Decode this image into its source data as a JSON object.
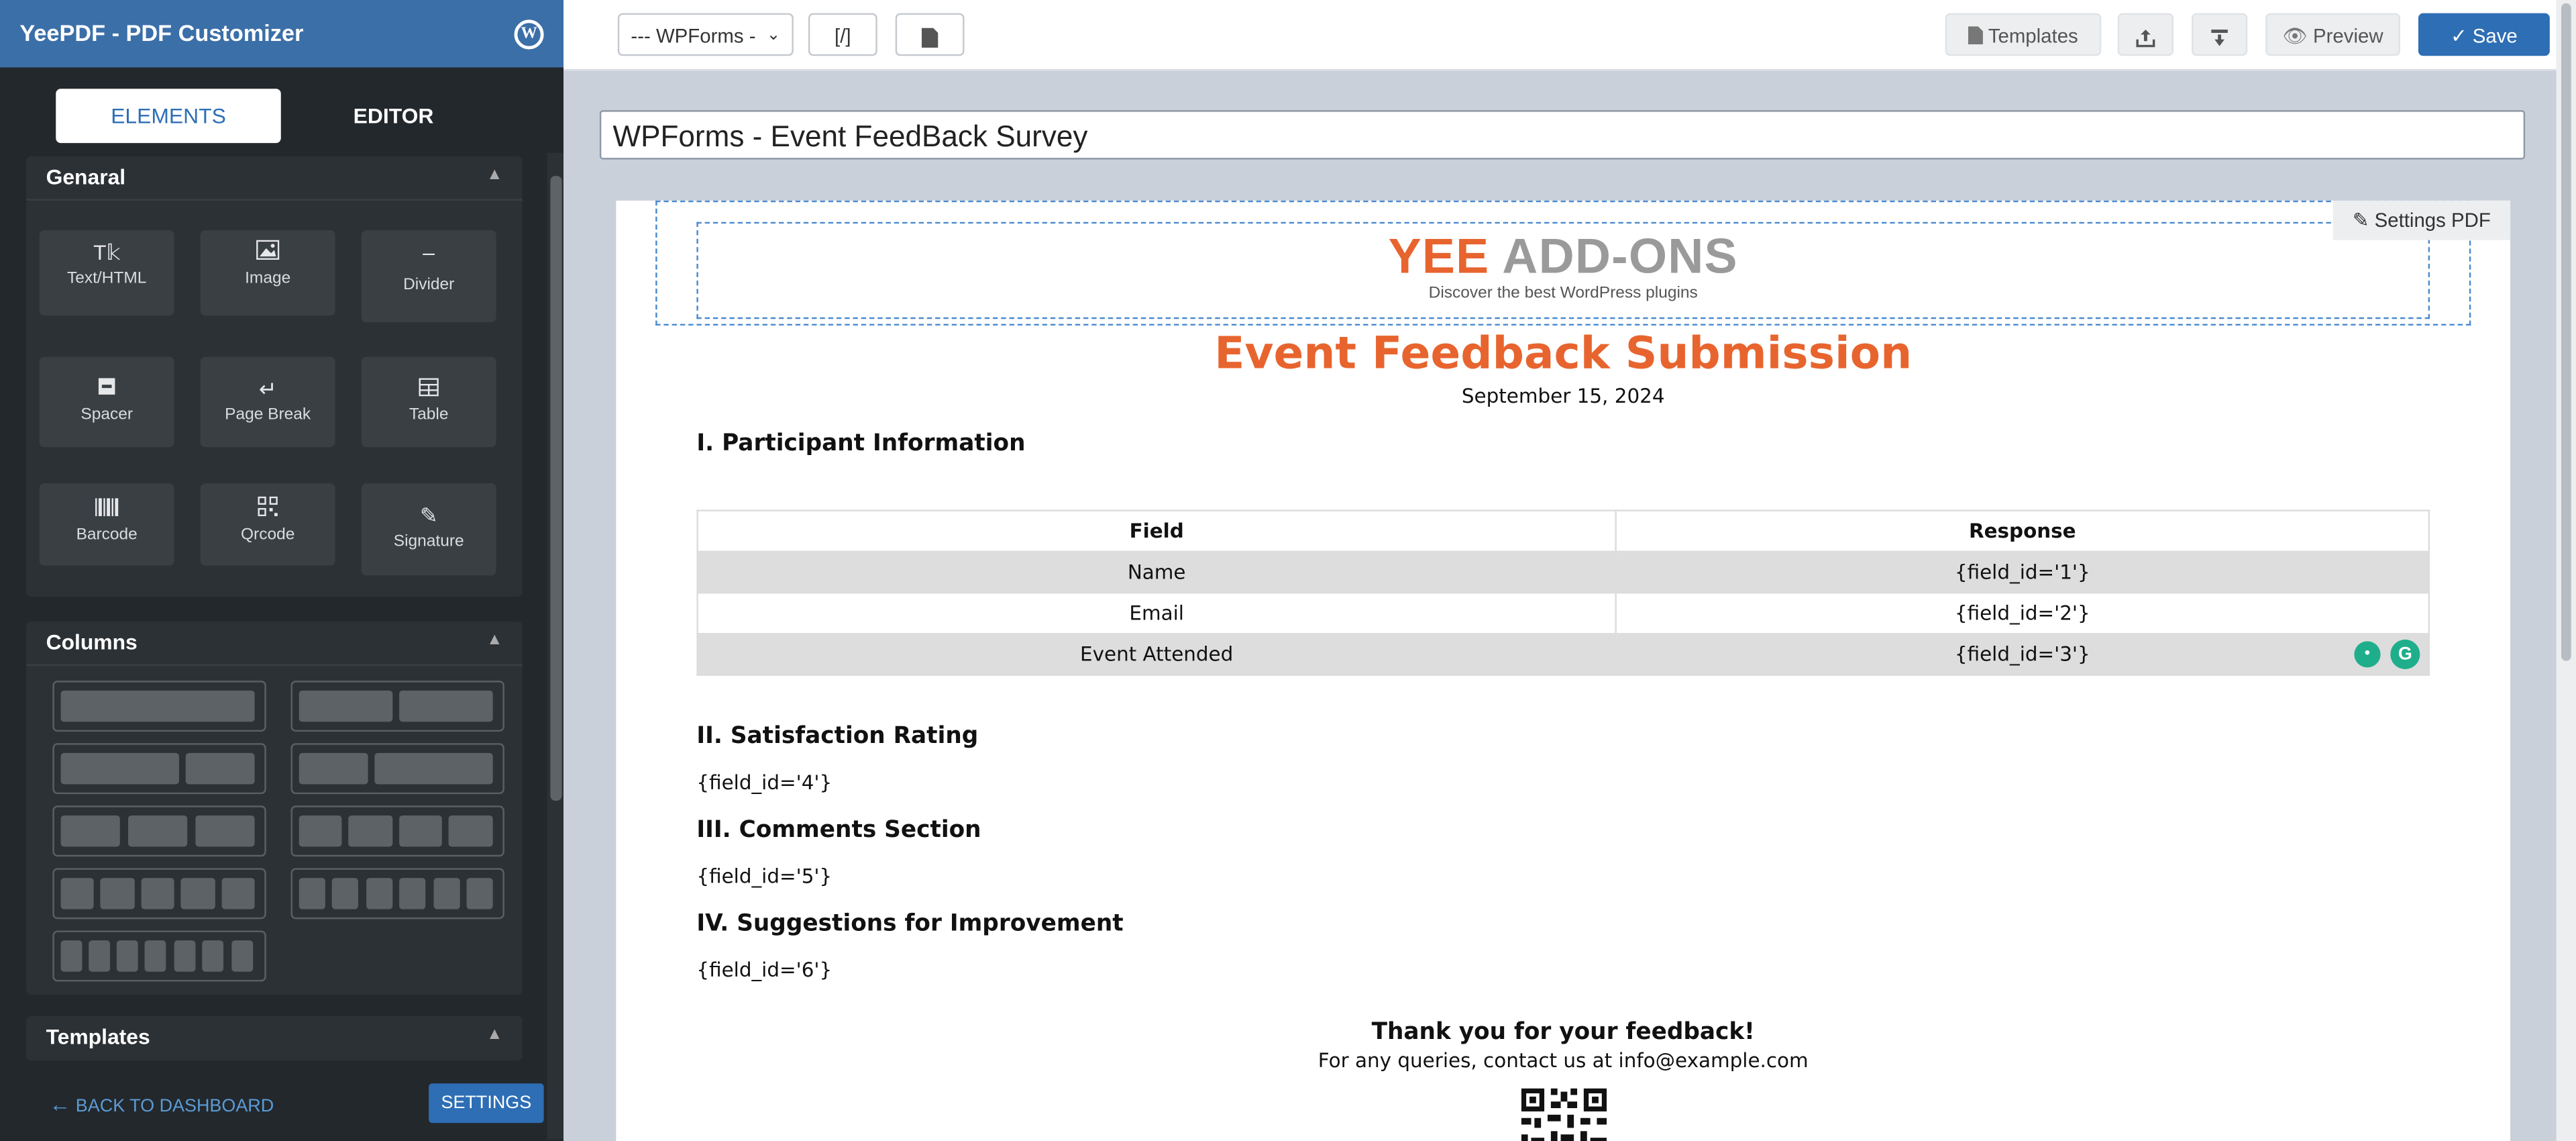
{
  "sidebar": {
    "app_title": "YeePDF - PDF Customizer",
    "tabs": [
      {
        "label": "ELEMENTS"
      },
      {
        "label": "EDITOR"
      }
    ],
    "general": {
      "title": "Genaral",
      "items": [
        {
          "label": "Text/HTML",
          "icon": "text-icon"
        },
        {
          "label": "Image",
          "icon": "image-icon"
        },
        {
          "label": "Divider",
          "icon": "divider-icon"
        },
        {
          "label": "Spacer",
          "icon": "spacer-icon"
        },
        {
          "label": "Page Break",
          "icon": "page-break-icon"
        },
        {
          "label": "Table",
          "icon": "table-icon"
        },
        {
          "label": "Barcode",
          "icon": "barcode-icon"
        },
        {
          "label": "Qrcode",
          "icon": "qrcode-icon"
        },
        {
          "label": "Signature",
          "icon": "signature-icon"
        }
      ]
    },
    "columns": {
      "title": "Columns"
    },
    "templates": {
      "title": "Templates"
    },
    "back_label": "BACK TO DASHBOARD",
    "settings_label": "SETTINGS"
  },
  "toolbar": {
    "form_select": "--- WPForms -",
    "shortcode_label": "[/]",
    "templates_label": "Templates",
    "preview_label": "Preview",
    "save_label": "Save"
  },
  "document": {
    "title_value": "WPForms - Event FeedBack Survey",
    "settings_pdf_label": "Settings PDF",
    "logo_part1": "YEE",
    "logo_part2": "ADD-ONS",
    "logo_tagline": "Discover the best WordPress plugins",
    "heading": "Event Feedback Submission",
    "date": "September 15, 2024",
    "section1": "I. Participant Information",
    "table": {
      "headers": [
        "Field",
        "Response"
      ],
      "rows": [
        [
          "Name",
          "{field_id='1'}"
        ],
        [
          "Email",
          "{field_id='2'}"
        ],
        [
          "Event Attended",
          "{field_id='3'}"
        ]
      ]
    },
    "section2": "II. Satisfaction Rating",
    "field4": "{field_id='4'}",
    "section3": "III. Comments Section",
    "field5": "{field_id='5'}",
    "section4": "IV. Suggestions for Improvement",
    "field6": "{field_id='6'}",
    "thanks": "Thank you for your feedback!",
    "contact": "For any queries, contact us at info@example.com"
  },
  "colors": {
    "accent": "#2e6eb5",
    "brand_orange": "#e8642e",
    "sidebar_bg": "#23282d"
  }
}
